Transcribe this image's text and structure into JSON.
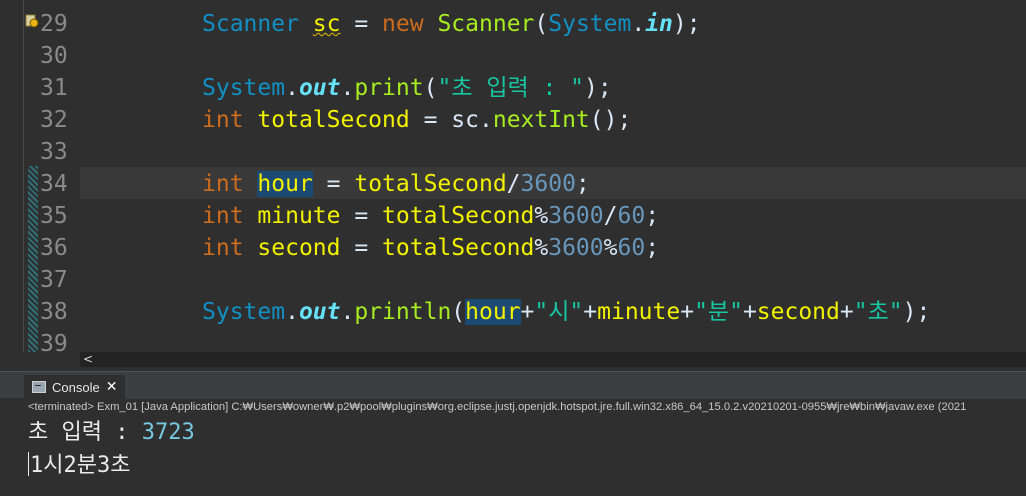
{
  "editor": {
    "lines": [
      {
        "n": "29",
        "tokens": [
          {
            "t": "Scanner",
            "c": "cls"
          },
          {
            "t": " "
          },
          {
            "t": "sc",
            "c": "var warn-squiggle"
          },
          {
            "t": " = "
          },
          {
            "t": "new",
            "c": "kw"
          },
          {
            "t": " "
          },
          {
            "t": "Scanner",
            "c": "meth"
          },
          {
            "t": "("
          },
          {
            "t": "System",
            "c": "cls"
          },
          {
            "t": "."
          },
          {
            "t": "in",
            "c": "fld"
          },
          {
            "t": ");"
          }
        ]
      },
      {
        "n": "30",
        "tokens": []
      },
      {
        "n": "31",
        "tokens": [
          {
            "t": "System",
            "c": "cls"
          },
          {
            "t": "."
          },
          {
            "t": "out",
            "c": "fld"
          },
          {
            "t": "."
          },
          {
            "t": "print",
            "c": "meth"
          },
          {
            "t": "("
          },
          {
            "t": "\"초 입력 : \"",
            "c": "str"
          },
          {
            "t": ");"
          }
        ]
      },
      {
        "n": "32",
        "tokens": [
          {
            "t": "int",
            "c": "kw"
          },
          {
            "t": " "
          },
          {
            "t": "totalSecond",
            "c": "var"
          },
          {
            "t": " = "
          },
          {
            "t": "sc"
          },
          {
            "t": "."
          },
          {
            "t": "nextInt",
            "c": "meth"
          },
          {
            "t": "();"
          }
        ]
      },
      {
        "n": "33",
        "tokens": []
      },
      {
        "n": "34",
        "tokens": [
          {
            "t": "int",
            "c": "kw"
          },
          {
            "t": " "
          },
          {
            "t": "hour",
            "c": "var hl"
          },
          {
            "t": " = "
          },
          {
            "t": "totalSecond",
            "c": "var"
          },
          {
            "t": "/"
          },
          {
            "t": "3600",
            "c": "num"
          },
          {
            "t": ";"
          }
        ]
      },
      {
        "n": "35",
        "tokens": [
          {
            "t": "int",
            "c": "kw"
          },
          {
            "t": " "
          },
          {
            "t": "minute",
            "c": "var"
          },
          {
            "t": " = "
          },
          {
            "t": "totalSecond",
            "c": "var"
          },
          {
            "t": "%"
          },
          {
            "t": "3600",
            "c": "num"
          },
          {
            "t": "/"
          },
          {
            "t": "60",
            "c": "num"
          },
          {
            "t": ";"
          }
        ]
      },
      {
        "n": "36",
        "tokens": [
          {
            "t": "int",
            "c": "kw"
          },
          {
            "t": " "
          },
          {
            "t": "second",
            "c": "var"
          },
          {
            "t": " = "
          },
          {
            "t": "totalSecond",
            "c": "var"
          },
          {
            "t": "%"
          },
          {
            "t": "3600",
            "c": "num"
          },
          {
            "t": "%"
          },
          {
            "t": "60",
            "c": "num"
          },
          {
            "t": ";"
          }
        ]
      },
      {
        "n": "37",
        "tokens": []
      },
      {
        "n": "38",
        "tokens": [
          {
            "t": "System",
            "c": "cls"
          },
          {
            "t": "."
          },
          {
            "t": "out",
            "c": "fld"
          },
          {
            "t": "."
          },
          {
            "t": "println",
            "c": "meth"
          },
          {
            "t": "("
          },
          {
            "t": "hour",
            "c": "var hl"
          },
          {
            "t": "+"
          },
          {
            "t": "\"시\"",
            "c": "str"
          },
          {
            "t": "+"
          },
          {
            "t": "minute",
            "c": "var"
          },
          {
            "t": "+"
          },
          {
            "t": "\"분\"",
            "c": "str"
          },
          {
            "t": "+"
          },
          {
            "t": "second",
            "c": "var"
          },
          {
            "t": "+"
          },
          {
            "t": "\"초\"",
            "c": "str"
          },
          {
            "t": ");"
          }
        ]
      },
      {
        "n": "39",
        "tokens": []
      }
    ]
  },
  "hscroll": {
    "left_arrow": "<"
  },
  "console": {
    "tab_label": "Console",
    "close_glyph": "✕",
    "status": "<terminated> Exm_01 [Java Application] C:₩Users₩owner₩.p2₩pool₩plugins₩org.eclipse.justj.openjdk.hotspot.jre.full.win32.x86_64_15.0.2.v20210201-0955₩jre₩bin₩javaw.exe  (2021",
    "prompt": "초 입력 : ",
    "input": "3723",
    "output": "1시2분3초"
  },
  "colors": {
    "keyword": "#cc6c1d",
    "class": "#1290c3",
    "variable": "#f2f200",
    "field": "#66e1f8",
    "method": "#a7ec21",
    "string": "#17c6a3",
    "number": "#6897bb",
    "highlight": "#1d4a74"
  }
}
